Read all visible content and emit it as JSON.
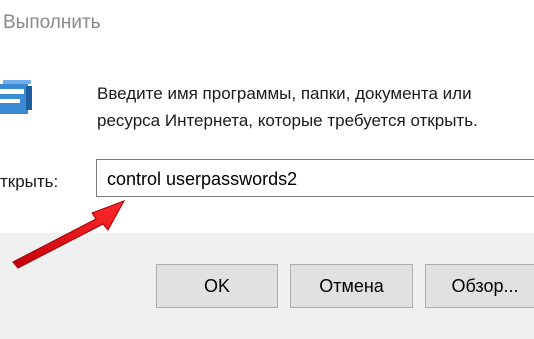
{
  "window": {
    "title": "Выполнить"
  },
  "dialog": {
    "description_line1": "Введите имя программы, папки, документа или",
    "description_line2": "ресурса Интернета, которые требуется открыть.",
    "open_label": "ткрыть:",
    "command_value": "control userpasswords2"
  },
  "buttons": {
    "ok_label": "OK",
    "cancel_label": "Отмена",
    "browse_label": "Обзор..."
  },
  "icons": {
    "app_icon": "run-dialog-icon",
    "annotation": "red-arrow-icon"
  },
  "colors": {
    "arrow": "#e8101a",
    "button_bar": "#f0f0f0",
    "icon_blue": "#3a8ad6"
  }
}
